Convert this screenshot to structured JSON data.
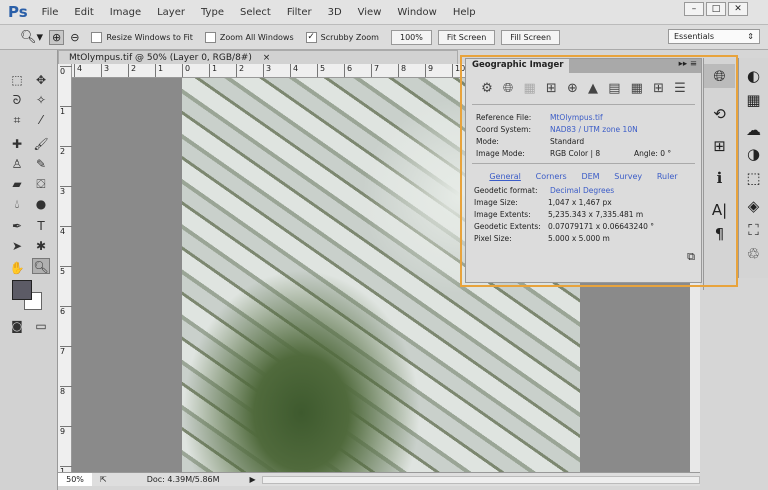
{
  "app": {
    "logo": "Ps",
    "menus": [
      "File",
      "Edit",
      "Image",
      "Layer",
      "Type",
      "Select",
      "Filter",
      "3D",
      "View",
      "Window",
      "Help"
    ],
    "window_controls": [
      "–",
      "□",
      "✕"
    ]
  },
  "options": {
    "resize_windows": "Resize Windows to Fit",
    "resize_checked": false,
    "zoom_all": "Zoom All Windows",
    "zoom_all_checked": false,
    "scrubby": "Scrubby Zoom",
    "scrubby_checked": true,
    "zoom_value": "100%",
    "fit_screen": "Fit Screen",
    "fill_screen": "Fill Screen",
    "workspace": "Essentials"
  },
  "document": {
    "tab_title": "MtOlympus.tif @ 50% (Layer 0, RGB/8#)",
    "close": "×",
    "ruler_top": [
      "4",
      "3",
      "2",
      "1",
      "0",
      "1",
      "2",
      "3",
      "4",
      "5",
      "6",
      "7",
      "8",
      "9",
      "10"
    ],
    "ruler_left": [
      "0",
      "1",
      "2",
      "3",
      "4",
      "5",
      "6",
      "7",
      "8",
      "9",
      "1"
    ],
    "zoom": "50%",
    "doc_info": "Doc: 4.39M/5.86M"
  },
  "panel": {
    "title": "Geographic Imager",
    "menu": "▸▸  ≡",
    "icons": [
      "settings-icon",
      "globe-icon",
      "tiles-icon",
      "grid-icon",
      "reproject-icon",
      "terrain-icon",
      "table-icon",
      "grid-export-icon",
      "add-icon",
      "menu-icon"
    ],
    "info": [
      {
        "label": "Reference File:",
        "value": "MtOlympus.tif",
        "link": true
      },
      {
        "label": "Coord System:",
        "value": "NAD83 / UTM zone 10N",
        "link": true
      },
      {
        "label": "Mode:",
        "value": "Standard",
        "link": false
      },
      {
        "label": "Image Mode:",
        "value": "RGB Color | 8",
        "link": false
      }
    ],
    "angle": "Angle: 0 °",
    "tabs": [
      "General",
      "Corners",
      "DEM",
      "Survey",
      "Ruler"
    ],
    "active_tab": "General",
    "details": [
      {
        "label": "Geodetic format:",
        "value": "Decimal Degrees"
      },
      {
        "label": "Image Size:",
        "value": "1,047 x 1,467 px"
      },
      {
        "label": "Image Extents:",
        "value": "5,235.343 x 7,335.481 m"
      },
      {
        "label": "Geodetic Extents:",
        "value": "0.07079171 x 0.06643240 °"
      },
      {
        "label": "Pixel Size:",
        "value": "5.000 x 5.000 m"
      }
    ]
  },
  "colors": {
    "highlight": "#e8a33c",
    "link": "#3b5cc7",
    "ps_blue": "#2a5fa8"
  }
}
